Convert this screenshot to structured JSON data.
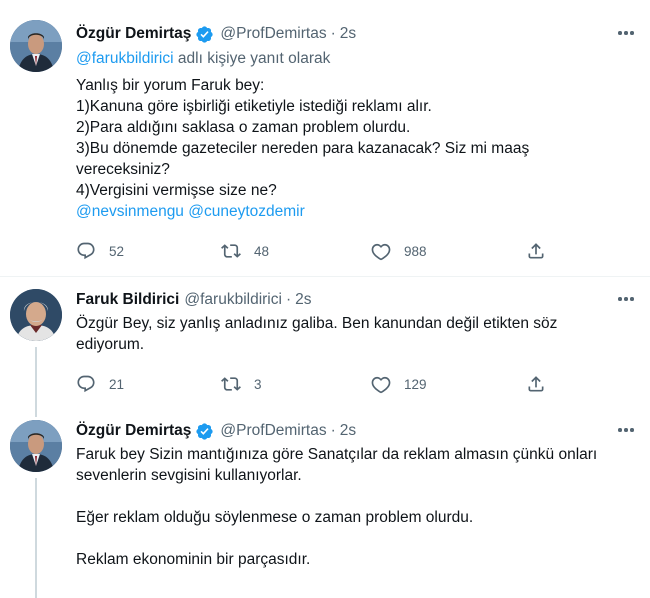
{
  "tweets": [
    {
      "name": "Özgür Demirtaş",
      "handle": "@ProfDemirtas",
      "time": "2s",
      "reply_to": {
        "mention": "@farukbildirici",
        "rest": "adlı kişiye yanıt olarak"
      },
      "lines": [
        "Yanlış bir yorum Faruk bey:",
        "1)Kanuna göre işbirliği etiketiyle istediği reklamı alır.",
        "2)Para aldığını saklasa o zaman problem olurdu.",
        "3)Bu dönemde gazeteciler nereden para kazanacak? Siz mi maaş",
        "vereceksiniz?",
        "4)Vergisini vermişse size ne?"
      ],
      "mentions_line": [
        "@nevsinmengu",
        "@cuneytozdemir"
      ],
      "stats": {
        "replies": "52",
        "retweets": "48",
        "likes": "988"
      }
    },
    {
      "name": "Faruk Bildirici",
      "handle": "@farukbildirici",
      "time": "2s",
      "lines": [
        "Özgür Bey, siz yanlış anladınız galiba. Ben kanundan değil etikten söz",
        "ediyorum."
      ],
      "stats": {
        "replies": "21",
        "retweets": "3",
        "likes": "129"
      }
    },
    {
      "name": "Özgür Demirtaş",
      "handle": "@ProfDemirtas",
      "time": "2s",
      "lines": [
        "Faruk bey Sizin mantığınıza göre Sanatçılar da reklam almasın çünkü onları",
        "sevenlerin sevgisini kullanıyorlar.",
        "",
        "Eğer reklam olduğu söylenmese o zaman problem olurdu.",
        "",
        "Reklam ekonominin bir parçasıdır."
      ]
    }
  ],
  "separator": "·",
  "colors": {
    "link": "#1d9bf0",
    "secondary": "#536471",
    "verified": "#1d9bf0"
  },
  "icons": {
    "reply": "reply-icon",
    "retweet": "retweet-icon",
    "like": "like-icon",
    "share": "share-icon",
    "more": "more-icon",
    "verified": "verified-badge-icon"
  }
}
